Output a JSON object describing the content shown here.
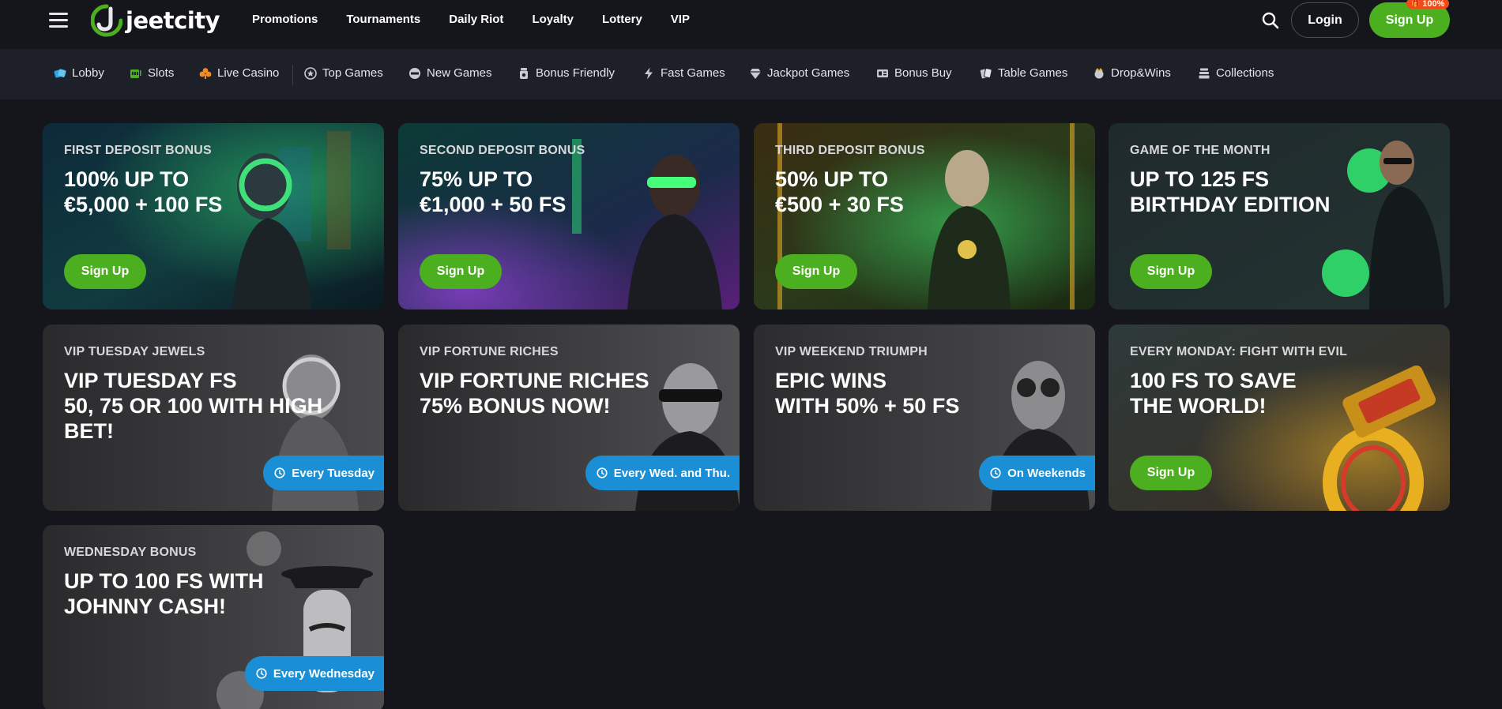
{
  "header": {
    "logo_text": "jeetcity",
    "nav": [
      "Promotions",
      "Tournaments",
      "Daily Riot",
      "Loyalty",
      "Lottery",
      "VIP"
    ],
    "login_label": "Login",
    "signup_label": "Sign Up",
    "signup_badge": "100%",
    "brand_color": "#4caf1f"
  },
  "categories": [
    {
      "label": "Lobby",
      "icon": "dice-icon"
    },
    {
      "label": "Slots",
      "icon": "slot-machine-icon"
    },
    {
      "label": "Live Casino",
      "icon": "club-icon"
    },
    {
      "label": "Top Games",
      "icon": "star-icon"
    },
    {
      "label": "New Games",
      "icon": "new-icon"
    },
    {
      "label": "Bonus Friendly",
      "icon": "bonus-jar-icon"
    },
    {
      "label": "Fast Games",
      "icon": "lightning-icon"
    },
    {
      "label": "Jackpot Games",
      "icon": "diamond-icon"
    },
    {
      "label": "Bonus Buy",
      "icon": "ticket-icon"
    },
    {
      "label": "Table Games",
      "icon": "cards-icon"
    },
    {
      "label": "Drop&Wins",
      "icon": "drop-wins-icon"
    },
    {
      "label": "Collections",
      "icon": "stack-icon"
    }
  ],
  "promos": [
    {
      "kicker": "FIRST DEPOSIT BONUS",
      "lines": [
        "100% UP TO",
        "€5,000 + 100 FS"
      ],
      "cta": "Sign Up",
      "pill": ""
    },
    {
      "kicker": "SECOND DEPOSIT BONUS",
      "lines": [
        "75% UP TO",
        "€1,000 + 50 FS"
      ],
      "cta": "Sign Up",
      "pill": ""
    },
    {
      "kicker": "THIRD DEPOSIT BONUS",
      "lines": [
        "50% UP TO",
        "€500 + 30 FS"
      ],
      "cta": "Sign Up",
      "pill": ""
    },
    {
      "kicker": "GAME OF THE MONTH",
      "lines": [
        "UP TO 125 FS",
        "BIRTHDAY EDITION"
      ],
      "cta": "Sign Up",
      "pill": ""
    },
    {
      "kicker": "VIP TUESDAY JEWELS",
      "lines": [
        "VIP TUESDAY FS",
        "50, 75 OR 100 WITH HIGH",
        "BET!"
      ],
      "cta": "",
      "pill": "Every Tuesday"
    },
    {
      "kicker": "VIP FORTUNE RICHES",
      "lines": [
        "VIP FORTUNE RICHES",
        "75% BONUS NOW!"
      ],
      "cta": "",
      "pill": "Every Wed. and Thu."
    },
    {
      "kicker": "VIP WEEKEND TRIUMPH",
      "lines": [
        "EPIC WINS",
        "WITH 50% + 50 FS"
      ],
      "cta": "",
      "pill": "On Weekends"
    },
    {
      "kicker": "EVERY MONDAY: FIGHT WITH EVIL",
      "lines": [
        "100 FS TO SAVE",
        "THE WORLD!"
      ],
      "cta": "Sign Up",
      "pill": ""
    },
    {
      "kicker": "WEDNESDAY BONUS",
      "lines": [
        "UP TO 100 FS WITH",
        "JOHNNY CASH!"
      ],
      "cta": "",
      "pill": "Every Wednesday"
    }
  ]
}
